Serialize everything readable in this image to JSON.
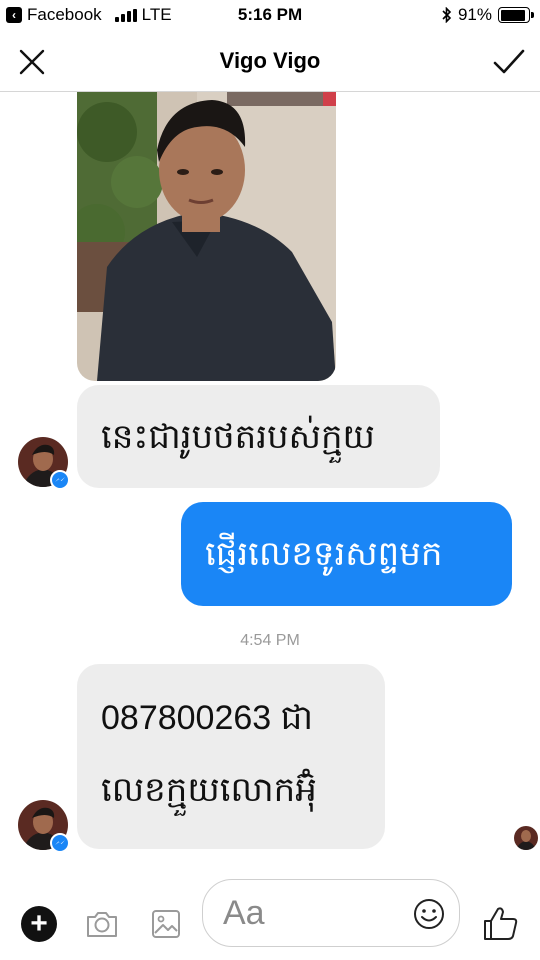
{
  "status_bar": {
    "back_app": "Facebook",
    "network": "LTE",
    "time": "5:16 PM",
    "battery": "91%",
    "battery_level": 0.91,
    "icons": [
      "back-arrow-icon",
      "signal-icon",
      "bluetooth-icon",
      "battery-icon"
    ]
  },
  "header": {
    "title": "Vigo Vigo",
    "left_icon": "close-icon",
    "right_icon": "checkmark-icon"
  },
  "messages": [
    {
      "direction": "incoming",
      "type": "photo"
    },
    {
      "direction": "incoming",
      "type": "text",
      "text": "នេះជារូបថតរបស់ក្មួយ"
    },
    {
      "direction": "outgoing",
      "type": "text",
      "text": "ផ្ញើរលេខទូរសព្ទមក"
    },
    {
      "type": "timestamp",
      "text": "4:54 PM"
    },
    {
      "direction": "incoming",
      "type": "text",
      "lines": [
        "087800263 ជា",
        "លេខក្មួយលោកអ៊ុំ"
      ]
    }
  ],
  "composer": {
    "placeholder": "Aa",
    "icons": [
      "plus-icon",
      "camera-icon",
      "gallery-icon",
      "emoji-icon",
      "thumbs-up-icon"
    ]
  },
  "colors": {
    "outgoing_bubble": "#1a86f6",
    "incoming_bubble": "#ededed",
    "timestamp_text": "#9a9a9a",
    "messenger_badge": "#1a86f6"
  }
}
